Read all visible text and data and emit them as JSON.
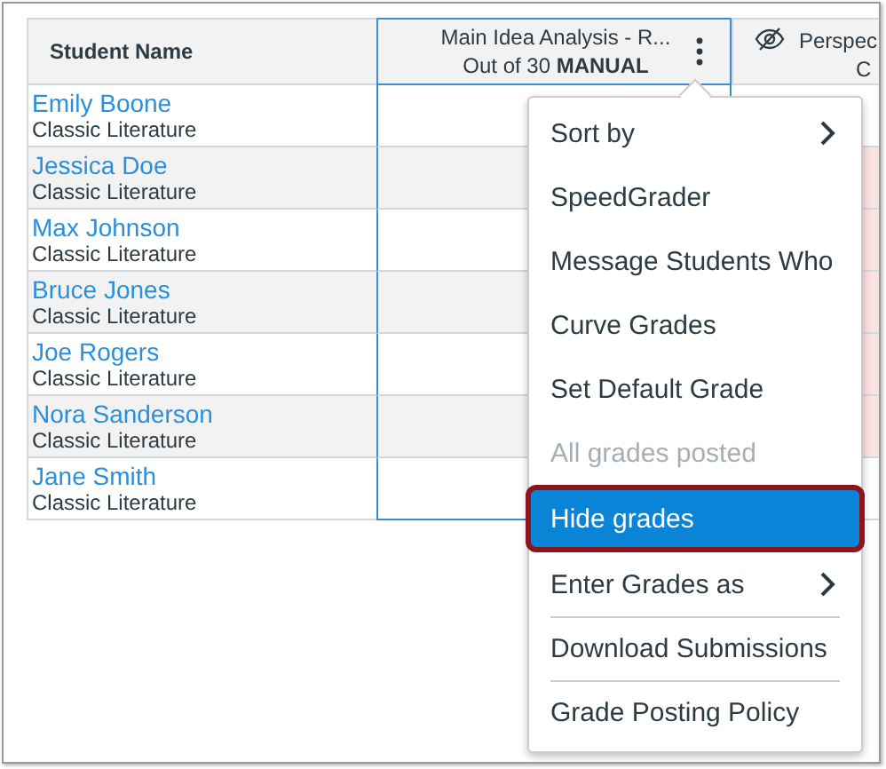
{
  "table": {
    "columns": [
      {
        "label": "Student Name"
      },
      {
        "label": "Main Idea Analysis - R...",
        "subtitle": "Out of 30 **MANUAL**",
        "selected": true
      },
      {
        "label": "Perspec",
        "subtitle": "C",
        "hidden_grades": true
      }
    ],
    "rows": [
      {
        "name": "Emily Boone",
        "section": "Classic Literature",
        "highlighted": false
      },
      {
        "name": "Jessica Doe",
        "section": "Classic Literature",
        "highlighted": true
      },
      {
        "name": "Max Johnson",
        "section": "Classic Literature",
        "highlighted": true
      },
      {
        "name": "Bruce Jones",
        "section": "Classic Literature",
        "highlighted": true
      },
      {
        "name": "Joe Rogers",
        "section": "Classic Literature",
        "highlighted": true
      },
      {
        "name": "Nora Sanderson",
        "section": "Classic Literature",
        "highlighted": true
      },
      {
        "name": "Jane Smith",
        "section": "Classic Literature",
        "highlighted": false
      }
    ]
  },
  "menu": {
    "items": [
      {
        "label": "Sort by",
        "submenu": true,
        "selected": false,
        "disabled": false,
        "divider_before": false
      },
      {
        "label": "SpeedGrader",
        "submenu": false,
        "selected": false,
        "disabled": false,
        "divider_before": false
      },
      {
        "label": "Message Students Who",
        "submenu": false,
        "selected": false,
        "disabled": false,
        "divider_before": false
      },
      {
        "label": "Curve Grades",
        "submenu": false,
        "selected": false,
        "disabled": false,
        "divider_before": false
      },
      {
        "label": "Set Default Grade",
        "submenu": false,
        "selected": false,
        "disabled": false,
        "divider_before": false
      },
      {
        "label": "All grades posted",
        "submenu": false,
        "selected": false,
        "disabled": true,
        "divider_before": false
      },
      {
        "label": "Hide grades",
        "submenu": false,
        "selected": true,
        "disabled": false,
        "divider_before": false
      },
      {
        "label": "Enter Grades as",
        "submenu": true,
        "selected": false,
        "disabled": false,
        "divider_before": false
      },
      {
        "label": "Download Submissions",
        "submenu": false,
        "selected": false,
        "disabled": false,
        "divider_before": true
      },
      {
        "label": "Grade Posting Policy",
        "submenu": false,
        "selected": false,
        "disabled": false,
        "divider_before": true
      }
    ]
  }
}
